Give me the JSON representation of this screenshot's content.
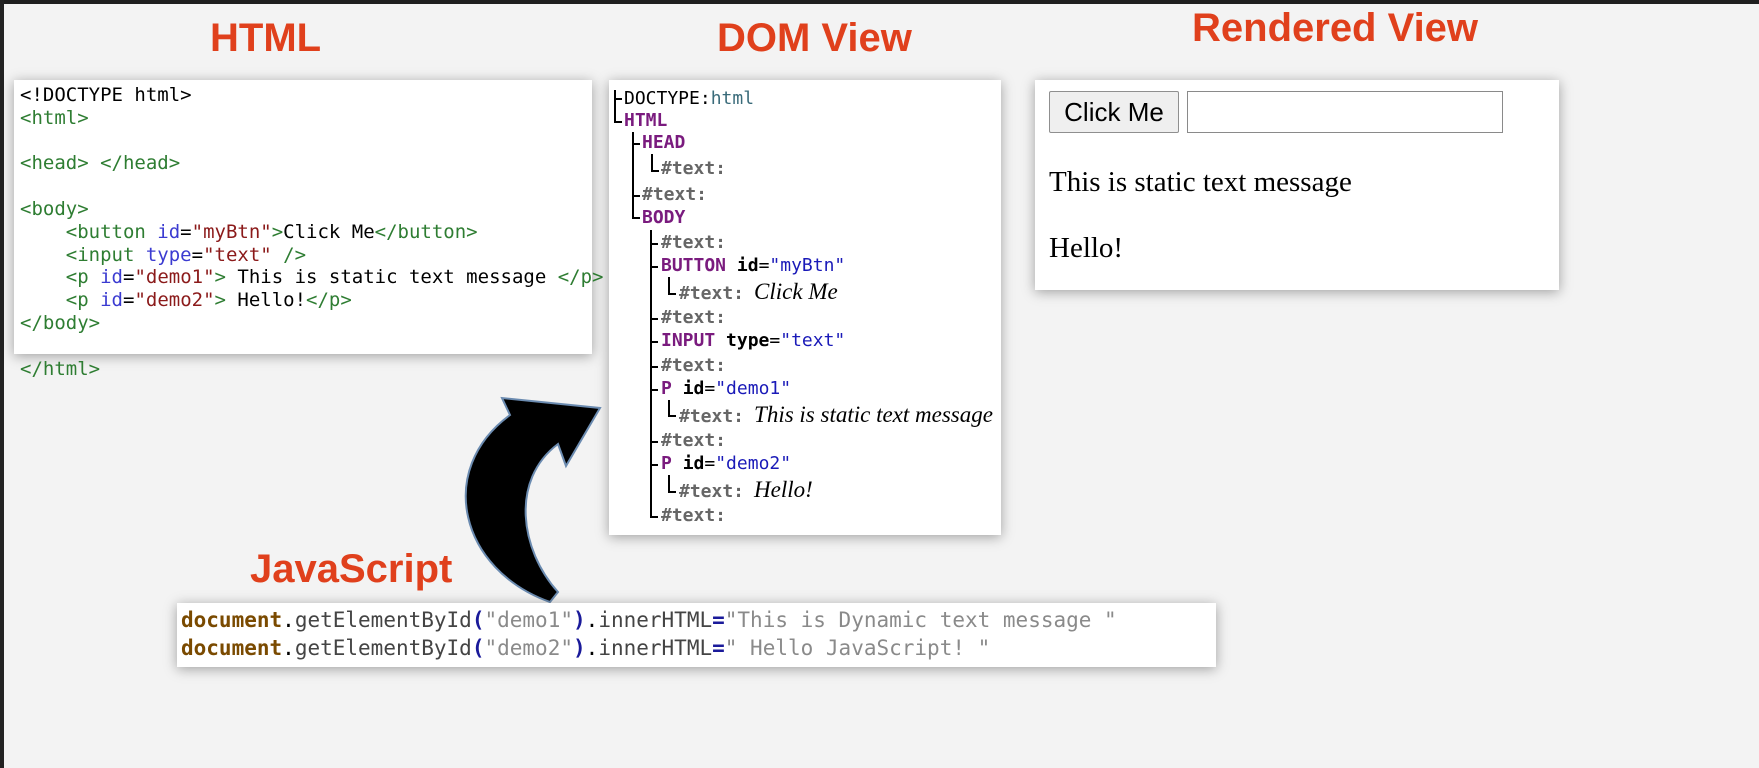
{
  "headings": {
    "html": "HTML",
    "dom": "DOM View",
    "rendered": "Rendered View",
    "javascript": "JavaScript"
  },
  "html_code": {
    "doctype": "<!DOCTYPE html>",
    "html_open": "<html>",
    "head": "<head> </head>",
    "body_open": "<body>",
    "button_open": "<button ",
    "button_attr": "id",
    "button_eq": "=",
    "button_val": "\"myBtn\"",
    "button_gt": ">",
    "button_text": "Click Me",
    "button_close": "</button>",
    "input_open": "<input ",
    "input_attr": "type",
    "input_eq": "=",
    "input_val": "\"text\"",
    "input_close": " />",
    "p1_open": "<p ",
    "p1_attr": "id",
    "p1_eq": "=",
    "p1_val": "\"demo1\"",
    "p1_gt": ">",
    "p1_text": " This is static text message ",
    "p1_close": "</p>",
    "p2_open": "<p ",
    "p2_attr": "id",
    "p2_eq": "=",
    "p2_val": "\"demo2\"",
    "p2_gt": ">",
    "p2_text": " Hello!",
    "p2_close": "</p>",
    "body_close": "</body>",
    "html_close": "</html>"
  },
  "dom_tree": {
    "doctype_label": "DOCTYPE: ",
    "doctype_value": "html",
    "html": "HTML",
    "head": "HEAD",
    "text": "#text:",
    "body": "BODY",
    "button": "BUTTON",
    "id_attr": "id",
    "type_attr": "type",
    "eq": "=",
    "button_id": "\"myBtn\"",
    "button_text": "Click Me",
    "input": "INPUT",
    "input_type": "\"text\"",
    "p": "P",
    "p1_id": "\"demo1\"",
    "p1_text": "This is static text message",
    "p2_id": "\"demo2\"",
    "p2_text": "Hello!"
  },
  "rendered": {
    "button_label": "Click Me",
    "input_value": "",
    "p1": "This is static text message",
    "p2": "Hello!"
  },
  "javascript": {
    "line1_obj": "document",
    "line1_method": "getElementById",
    "line1_arg": "\"demo1\"",
    "line1_prop": "innerHTML",
    "line1_value": "\"This is Dynamic text message \"",
    "line2_obj": "document",
    "line2_method": "getElementById",
    "line2_arg": "\"demo2\"",
    "line2_prop": "innerHTML",
    "line2_value": "\" Hello JavaScript! \""
  }
}
